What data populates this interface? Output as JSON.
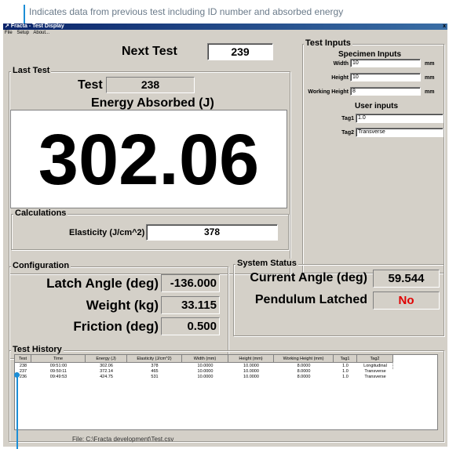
{
  "annotations": {
    "top": "Indicates data from previous test including ID number and absorbed energy"
  },
  "window": {
    "title": "Fracta - Test Display",
    "close_glyph": "x",
    "menu": [
      "File",
      "Setup",
      "About..."
    ]
  },
  "next_test": {
    "label": "Next Test",
    "value": "239"
  },
  "last_test": {
    "group_label": "Last Test",
    "test_label": "Test",
    "test_value": "238",
    "energy_label": "Energy Absorbed (J)",
    "energy_value": "302.06"
  },
  "calculations": {
    "group_label": "Calculations",
    "elasticity_label": "Elasticity (J/cm^2)",
    "elasticity_value": "378"
  },
  "test_inputs": {
    "group_label": "Test Inputs",
    "specimen_heading": "Specimen Inputs",
    "width_label": "Width",
    "width_value": "10",
    "width_unit": "mm",
    "height_label": "Height",
    "height_value": "10",
    "height_unit": "mm",
    "working_height_label": "Working Height",
    "working_height_value": "8",
    "working_height_unit": "mm",
    "user_heading": "User inputs",
    "tag1_label": "Tag1",
    "tag1_value": "1.0",
    "tag2_label": "Tag2",
    "tag2_value": "Transverse"
  },
  "configuration": {
    "group_label": "Configuration",
    "latch_label": "Latch Angle (deg)",
    "latch_value": "-136.000",
    "weight_label": "Weight (kg)",
    "weight_value": "33.115",
    "friction_label": "Friction (deg)",
    "friction_value": "0.500"
  },
  "system_status": {
    "group_label": "System Status",
    "current_angle_label": "Current Angle (deg)",
    "current_angle_value": "59.544",
    "pendulum_label": "Pendulum Latched",
    "pendulum_value": "No",
    "pendulum_color": "#e00000"
  },
  "test_history": {
    "group_label": "Test History",
    "columns": [
      "Test",
      "Time",
      "Energy (J)",
      "Elasticity (J/cm^2)",
      "Width (mm)",
      "Height (mm)",
      "Working Height (mm)",
      "Tag1",
      "Tag2"
    ],
    "rows": [
      [
        "238",
        "09:51:00",
        "302.06",
        "378",
        "10.0000",
        "10.0000",
        "8.0000",
        "1.0",
        "Longitudinal"
      ],
      [
        "237",
        "09:50:11",
        "372.14",
        "465",
        "10.0000",
        "10.0000",
        "8.0000",
        "1.0",
        "Transverse"
      ],
      [
        "236",
        "09:49:53",
        "424.75",
        "531",
        "10.0000",
        "10.0000",
        "8.0000",
        "1.0",
        "Transverse"
      ]
    ],
    "file_label": "File:  C:\\Fracta development\\Test.csv"
  },
  "colors": {
    "callout": "#1c8ed6",
    "window_bg": "#d4d0c8",
    "titlebar": "#0a246a"
  }
}
